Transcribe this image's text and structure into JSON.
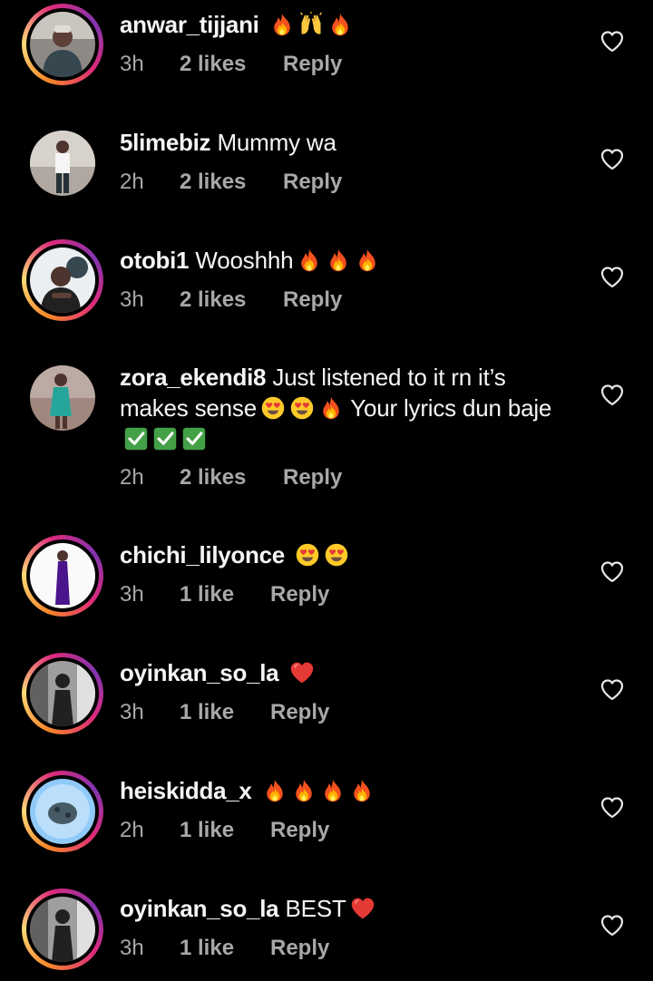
{
  "colors": {
    "background": "#000000",
    "text": "#f5f5f5",
    "meta": "#a8a8a8"
  },
  "comments": [
    {
      "username": "anwar_tijjani",
      "text": "",
      "emojis": [
        "fire",
        "raising-hands",
        "fire"
      ],
      "time": "3h",
      "likes": "2 likes",
      "reply": "Reply",
      "story_ring": true
    },
    {
      "username": "5limebiz",
      "text": "Mummy wa",
      "emojis": [],
      "time": "2h",
      "likes": "2 likes",
      "reply": "Reply",
      "story_ring": false
    },
    {
      "username": "otobi1",
      "text": "Wooshhh",
      "emojis": [
        "fire",
        "fire",
        "fire"
      ],
      "time": "3h",
      "likes": "2 likes",
      "reply": "Reply",
      "story_ring": true
    },
    {
      "username": "zora_ekendi8",
      "text_parts": [
        "Just listened to it rn it’s makes sense",
        "Your lyrics dun baje"
      ],
      "emojis_after_part1": [
        "heart-eyes",
        "heart-eyes",
        "fire"
      ],
      "emojis_after_part2": [
        "check",
        "check",
        "check"
      ],
      "time": "2h",
      "likes": "2 likes",
      "reply": "Reply",
      "story_ring": false
    },
    {
      "username": "chichi_lilyonce",
      "text": "",
      "emojis": [
        "heart-eyes",
        "heart-eyes"
      ],
      "time": "3h",
      "likes": "1 like",
      "reply": "Reply",
      "story_ring": true
    },
    {
      "username": "oyinkan_so_la",
      "text": "",
      "emojis": [
        "red-heart"
      ],
      "time": "3h",
      "likes": "1 like",
      "reply": "Reply",
      "story_ring": true
    },
    {
      "username": "heiskidda_x",
      "text": "",
      "emojis": [
        "fire",
        "fire",
        "fire",
        "fire"
      ],
      "time": "2h",
      "likes": "1 like",
      "reply": "Reply",
      "story_ring": true
    },
    {
      "username": "oyinkan_so_la",
      "text": "BEST",
      "emojis": [
        "red-heart"
      ],
      "time": "3h",
      "likes": "1 like",
      "reply": "Reply",
      "story_ring": true
    }
  ],
  "icons": {
    "like": "heart-outline-icon"
  }
}
